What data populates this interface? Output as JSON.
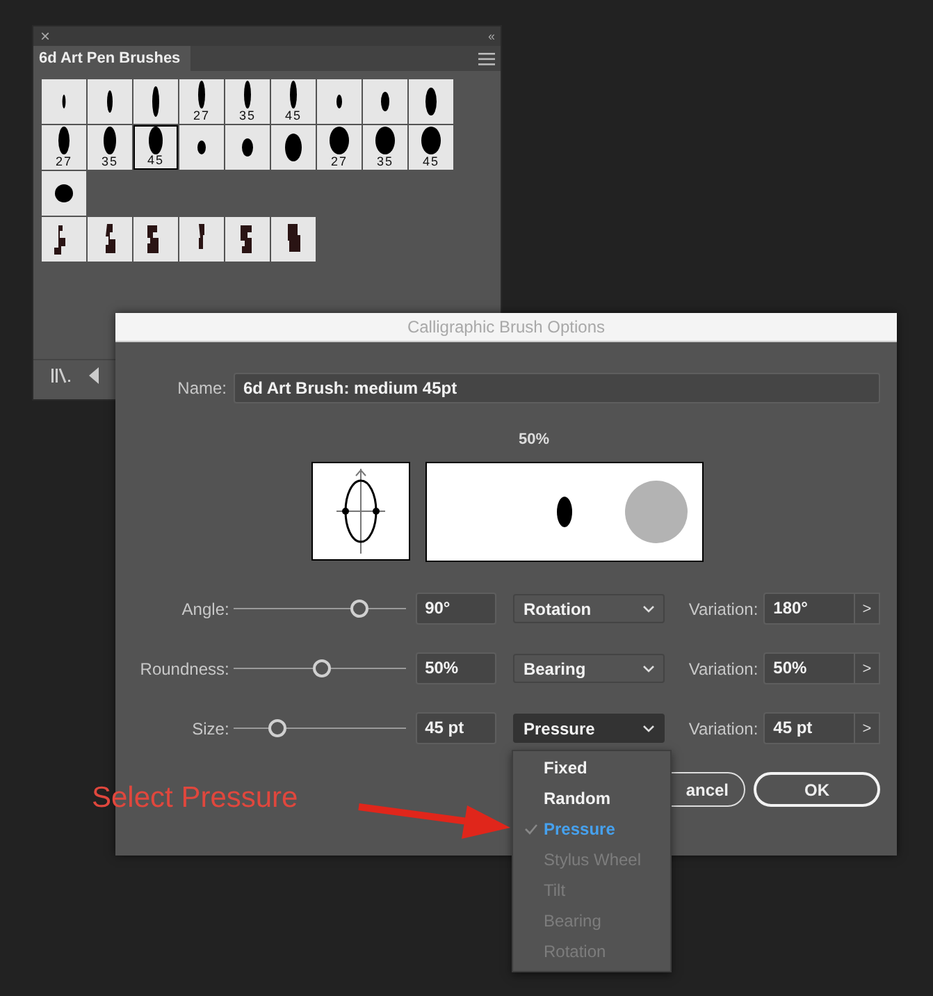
{
  "brushes_panel": {
    "close": "×",
    "collapse": "‹‹",
    "tabs": [
      {
        "label": "6d Art Pen Brushes",
        "selected": true
      }
    ],
    "brush_rows": [
      [
        {
          "kind": "stroke",
          "selected": false
        },
        {
          "kind": "stroke",
          "selected": false
        },
        {
          "kind": "stroke",
          "selected": false
        },
        {
          "kind": "stroke",
          "label": "27",
          "selected": false
        },
        {
          "kind": "stroke",
          "label": "35",
          "selected": false
        },
        {
          "kind": "stroke",
          "label": "45",
          "selected": false
        },
        {
          "kind": "stroke",
          "selected": false
        },
        {
          "kind": "stroke",
          "selected": false
        },
        {
          "kind": "stroke",
          "selected": false
        }
      ],
      [
        {
          "kind": "stroke",
          "label": "27",
          "selected": false
        },
        {
          "kind": "stroke",
          "label": "35",
          "selected": false
        },
        {
          "kind": "stroke",
          "label": "45",
          "selected": true
        },
        {
          "kind": "stroke",
          "selected": false
        },
        {
          "kind": "stroke",
          "selected": false
        },
        {
          "kind": "stroke",
          "selected": false
        },
        {
          "kind": "stroke",
          "label": "27",
          "selected": false
        },
        {
          "kind": "stroke",
          "label": "35",
          "selected": false
        },
        {
          "kind": "stroke",
          "label": "45",
          "selected": false
        }
      ],
      [
        {
          "kind": "dot",
          "selected": false
        }
      ],
      [
        {
          "kind": "splatter",
          "selected": false
        },
        {
          "kind": "splatter",
          "selected": false
        },
        {
          "kind": "splatter",
          "selected": false
        },
        {
          "kind": "splatter",
          "selected": false
        },
        {
          "kind": "splatter",
          "selected": false
        },
        {
          "kind": "splatter",
          "selected": false
        }
      ]
    ]
  },
  "dialog": {
    "title": "Calligraphic Brush Options",
    "name_label": "Name:",
    "name_value": "6d Art Brush: medium 45pt",
    "preview_reading": "50%",
    "rows": [
      {
        "label": "Angle:",
        "level": 0.73,
        "value": "90°",
        "mode": "Rotation",
        "open": false,
        "variation_label": "Variation:",
        "variation": "180°",
        "stepper": ">"
      },
      {
        "label": "Roundness:",
        "level": 0.51,
        "value": "50%",
        "mode": "Bearing",
        "open": false,
        "variation_label": "Variation:",
        "variation": "50%",
        "stepper": ">"
      },
      {
        "label": "Size:",
        "level": 0.25,
        "value": "45 pt",
        "mode": "Pressure",
        "open": true,
        "variation_label": "Variation:",
        "variation": "45 pt",
        "stepper": ">"
      }
    ],
    "buttons": [
      {
        "label": "ancel",
        "kind": "secondary"
      },
      {
        "label": "OK",
        "kind": "primary"
      }
    ],
    "menu": [
      {
        "label": "Fixed",
        "selected": false,
        "disabled": false
      },
      {
        "label": "Random",
        "selected": false,
        "disabled": false
      },
      {
        "label": "Pressure",
        "selected": true,
        "disabled": false
      },
      {
        "label": "Stylus Wheel",
        "selected": false,
        "disabled": true
      },
      {
        "label": "Tilt",
        "selected": false,
        "disabled": true
      },
      {
        "label": "Bearing",
        "selected": false,
        "disabled": true
      },
      {
        "label": "Rotation",
        "selected": false,
        "disabled": true
      }
    ]
  },
  "annotation": {
    "text": "Select Pressure"
  }
}
